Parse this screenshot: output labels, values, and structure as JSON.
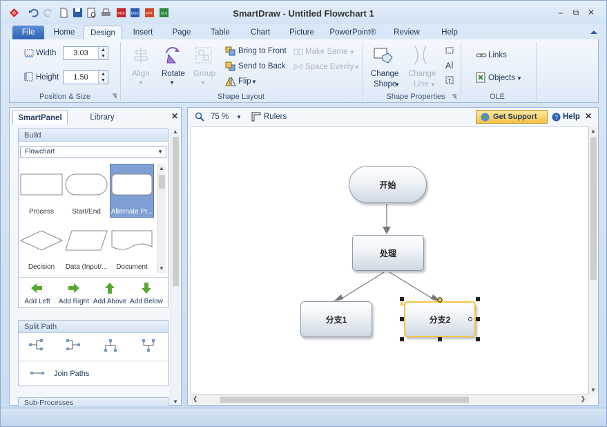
{
  "window": {
    "title": "SmartDraw - Untitled Flowchart 1"
  },
  "tabs": [
    "File",
    "Home",
    "Design",
    "Insert",
    "Page",
    "Table",
    "Chart",
    "Picture",
    "PowerPoint®",
    "Review",
    "Help"
  ],
  "ribbon": {
    "size": {
      "width_label": "Width",
      "width_value": "3.03",
      "height_label": "Height",
      "height_value": "1.50",
      "group": "Position & Size"
    },
    "layout": {
      "align": "Align",
      "rotate": "Rotate",
      "group_btn": "Group",
      "bring_front": "Bring to Front",
      "send_back": "Send to Back",
      "flip": "Flip",
      "make_same": "Make Same",
      "space_evenly": "Space Evenly",
      "group": "Shape Layout"
    },
    "props": {
      "change_shape_1": "Change",
      "change_shape_2": "Shape",
      "change_line_1": "Change",
      "change_line_2": "Line",
      "group": "Shape Properties"
    },
    "ole": {
      "links": "Links",
      "objects": "Objects",
      "group": "OLE"
    }
  },
  "panel": {
    "tabs": [
      "SmartPanel",
      "Library"
    ],
    "build": {
      "header": "Build",
      "dropdown": "Flowchart",
      "shapes": [
        "Process",
        "Start/End",
        "Alternate Pr...",
        "Decision",
        "Data (Input/...",
        "Document"
      ],
      "actions": [
        "Add Left",
        "Add Right",
        "Add Above",
        "Add Below"
      ]
    },
    "split": {
      "header": "Split Path",
      "join": "Join Paths"
    },
    "sub": {
      "header": "Sub-Processes"
    }
  },
  "canvas": {
    "zoom": "75 %",
    "rulers": "Rulers",
    "support": "Get Support",
    "help": "Help",
    "nodes": {
      "start": "开始",
      "process": "处理",
      "branch1": "分支1",
      "branch2": "分支2"
    }
  },
  "colors": {
    "accent": "#2f63b0",
    "selection": "#f5c242"
  }
}
